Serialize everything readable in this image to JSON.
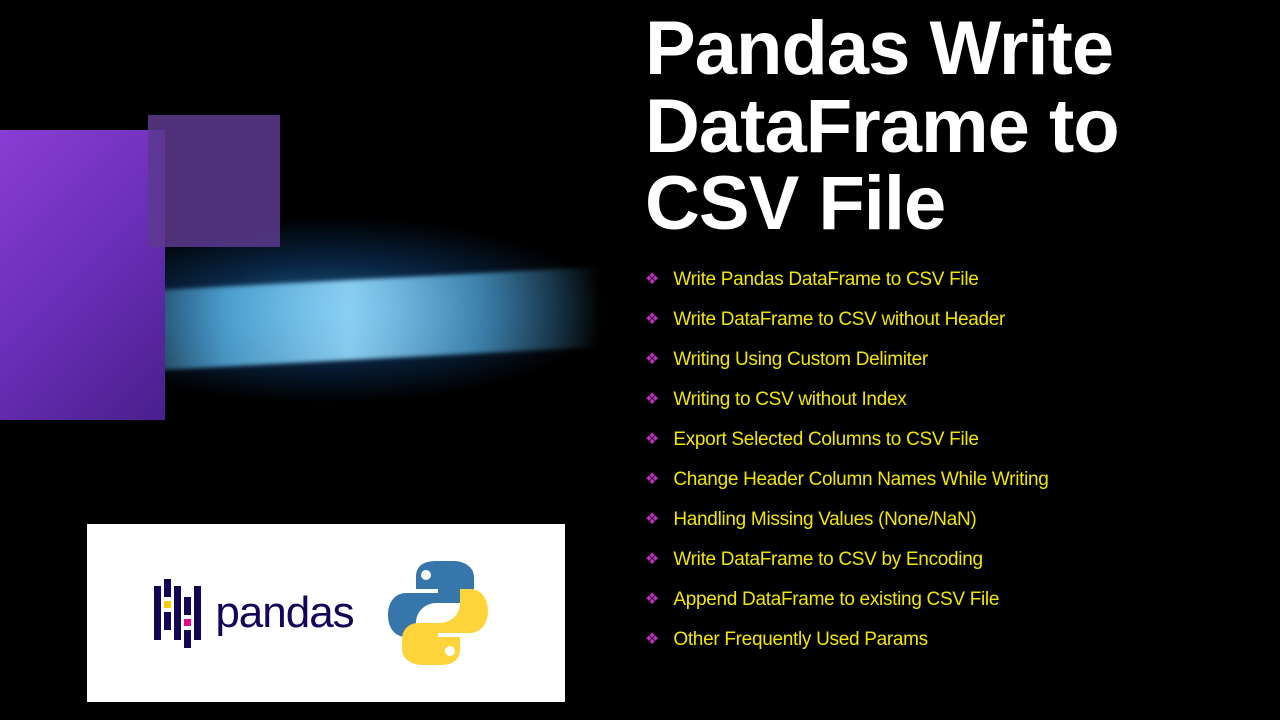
{
  "title": "Pandas Write DataFrame to CSV File",
  "logo_text": "pandas",
  "bullets": [
    "Write Pandas DataFrame to CSV File",
    "Write DataFrame to CSV without Header",
    "Writing Using Custom Delimiter",
    "Writing to CSV without Index",
    "Export Selected Columns to CSV File",
    "Change Header Column Names While Writing",
    "Handling Missing Values (None/NaN)",
    "Write DataFrame to CSV by Encoding",
    "Append DataFrame to existing CSV File",
    "Other Frequently Used Params"
  ],
  "colors": {
    "accent_yellow": "#f2e600",
    "accent_magenta": "#c030c0",
    "navy": "#130655"
  }
}
